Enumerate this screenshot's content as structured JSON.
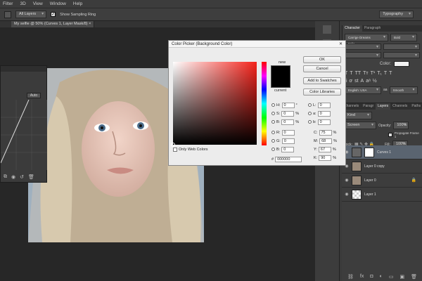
{
  "menu": [
    "Filter",
    "3D",
    "View",
    "Window",
    "Help"
  ],
  "options": {
    "layers_select": "All Layers",
    "sampling_ring": "Show Sampling Ring",
    "workspace": "Typography"
  },
  "document_tab": "My selfie @ 50% (Curves 1, Layer Mask/8)",
  "curves_panel": {
    "auto_label": "Auto"
  },
  "picker": {
    "title": "Color Picker (Background Color)",
    "buttons": {
      "ok": "OK",
      "cancel": "Cancel",
      "add": "Add to Swatches",
      "libraries": "Color Libraries"
    },
    "new_label": "new",
    "current_label": "current",
    "hsb": {
      "H": "0",
      "S": "0",
      "B": "0"
    },
    "rgb": {
      "R": "0",
      "G": "0",
      "B": "0"
    },
    "lab": {
      "L": "0",
      "a": "0",
      "b": "0"
    },
    "cmyk": {
      "C": "75",
      "M": "68",
      "Y": "67",
      "K": "90"
    },
    "hex": "000000",
    "only_web": "Only Web Colors",
    "unit_deg": "°",
    "unit_pct": "%"
  },
  "char_panel": {
    "tabs": [
      "Character",
      "Paragraph"
    ],
    "font": "Carrige Dreams Italic",
    "style": "Bold",
    "color_label": "Color:",
    "lang": "English: USA",
    "aa": "Smooth"
  },
  "layers_panel": {
    "tabs": [
      "Channels",
      "Paragr",
      "Layers",
      "Channels",
      "Paths"
    ],
    "kind": "Kind",
    "blend": "Screen",
    "opacity_label": "Opacity:",
    "opacity": "100%",
    "propagate": "Propagate Frame 1",
    "lock_label": "Lock:",
    "fill_label": "Fill:",
    "fill": "100%",
    "layers": [
      {
        "name": "Curves 1"
      },
      {
        "name": "Layer 0 copy"
      },
      {
        "name": "Layer 0"
      },
      {
        "name": "Layer 1"
      }
    ]
  }
}
